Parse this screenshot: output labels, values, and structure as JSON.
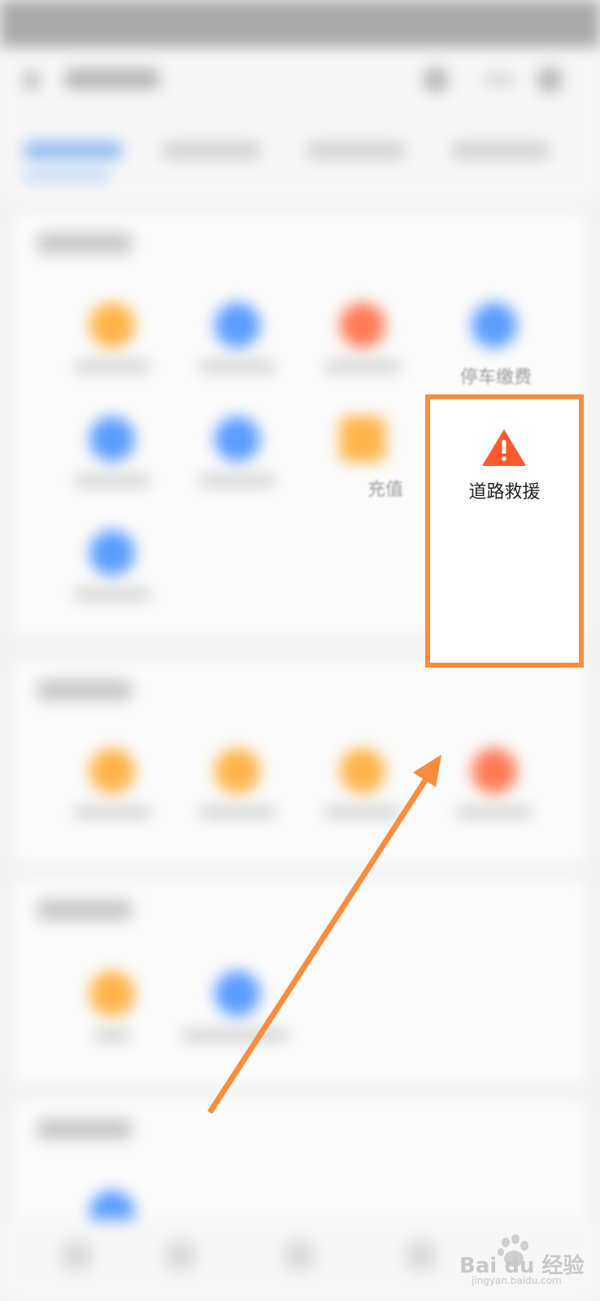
{
  "services": {
    "peek_parking_label": "停车缴费",
    "peek_recharge_label": "充值",
    "highlighted": {
      "label": "道路救援",
      "icon": "warning-triangle-icon",
      "icon_color": "#fb5a2e",
      "highlight_color": "#fb8c3b"
    }
  },
  "watermark": {
    "brand": "Bai du 经验",
    "domain": "jingyan.baidu.com"
  }
}
